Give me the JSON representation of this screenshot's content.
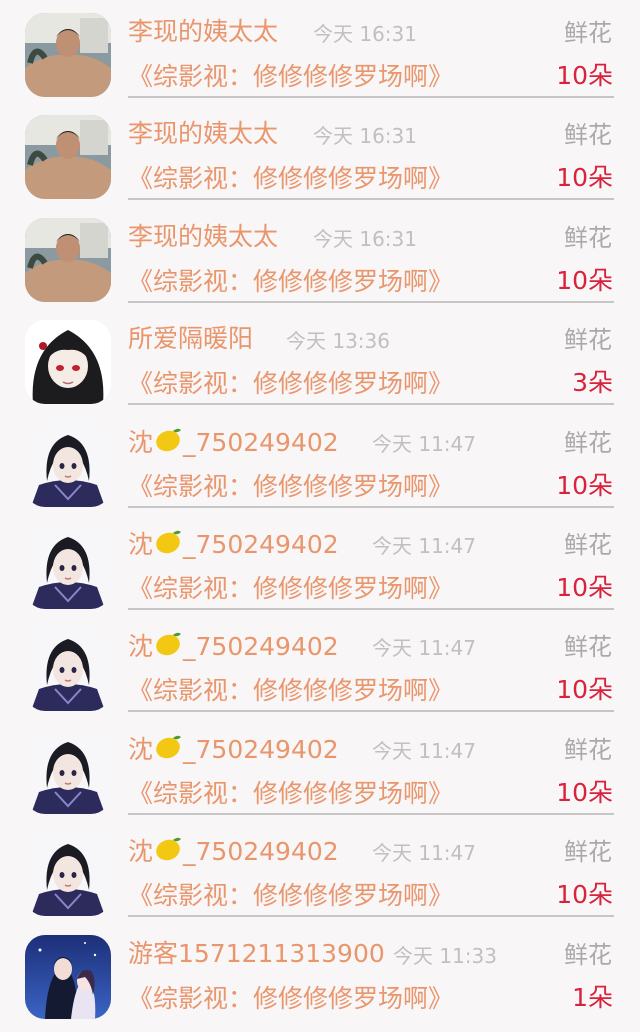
{
  "colors": {
    "name": "#e9966c",
    "time": "#c0c0c0",
    "gift": "#aaaaaa",
    "count": "#d9223c",
    "divider": "#c6c6c6",
    "background": "#f8f6f7"
  },
  "rows": [
    {
      "avatar": "shirtless-man-avatar",
      "name": "李现的姨太太",
      "time": "今天 16:31",
      "gift": "鲜花",
      "book": "《综影视：修修修修罗场啊》",
      "count": "10朵"
    },
    {
      "avatar": "shirtless-man-avatar",
      "name": "李现的姨太太",
      "time": "今天 16:31",
      "gift": "鲜花",
      "book": "《综影视：修修修修罗场啊》",
      "count": "10朵"
    },
    {
      "avatar": "shirtless-man-avatar",
      "name": "李现的姨太太",
      "time": "今天 16:31",
      "gift": "鲜花",
      "book": "《综影视：修修修修罗场啊》",
      "count": "10朵"
    },
    {
      "avatar": "anime-dark-hair-red-eyes-avatar",
      "name": "所爱隔暖阳",
      "time": "今天 13:36",
      "gift": "鲜花",
      "book": "《综影视：修修修修罗场啊》",
      "count": "3朵"
    },
    {
      "avatar": "anime-warrior-avatar",
      "name": "沈",
      "name_icon": "lemon-icon",
      "name_suffix": "_750249402",
      "time": "今天 11:47",
      "gift": "鲜花",
      "book": "《综影视：修修修修罗场啊》",
      "count": "10朵"
    },
    {
      "avatar": "anime-warrior-avatar",
      "name": "沈",
      "name_icon": "lemon-icon",
      "name_suffix": "_750249402",
      "time": "今天 11:47",
      "gift": "鲜花",
      "book": "《综影视：修修修修罗场啊》",
      "count": "10朵"
    },
    {
      "avatar": "anime-warrior-avatar",
      "name": "沈",
      "name_icon": "lemon-icon",
      "name_suffix": "_750249402",
      "time": "今天 11:47",
      "gift": "鲜花",
      "book": "《综影视：修修修修罗场啊》",
      "count": "10朵"
    },
    {
      "avatar": "anime-warrior-avatar",
      "name": "沈",
      "name_icon": "lemon-icon",
      "name_suffix": "_750249402",
      "time": "今天 11:47",
      "gift": "鲜花",
      "book": "《综影视：修修修修罗场啊》",
      "count": "10朵"
    },
    {
      "avatar": "anime-warrior-avatar",
      "name": "沈",
      "name_icon": "lemon-icon",
      "name_suffix": "_750249402",
      "time": "今天 11:47",
      "gift": "鲜花",
      "book": "《综影视：修修修修罗场啊》",
      "count": "10朵"
    },
    {
      "avatar": "anime-couple-avatar",
      "name": "游客1571211313900",
      "time": "今天 11:33",
      "gift": "鲜花",
      "book": "《综影视：修修修修罗场啊》",
      "count": "1朵"
    }
  ]
}
